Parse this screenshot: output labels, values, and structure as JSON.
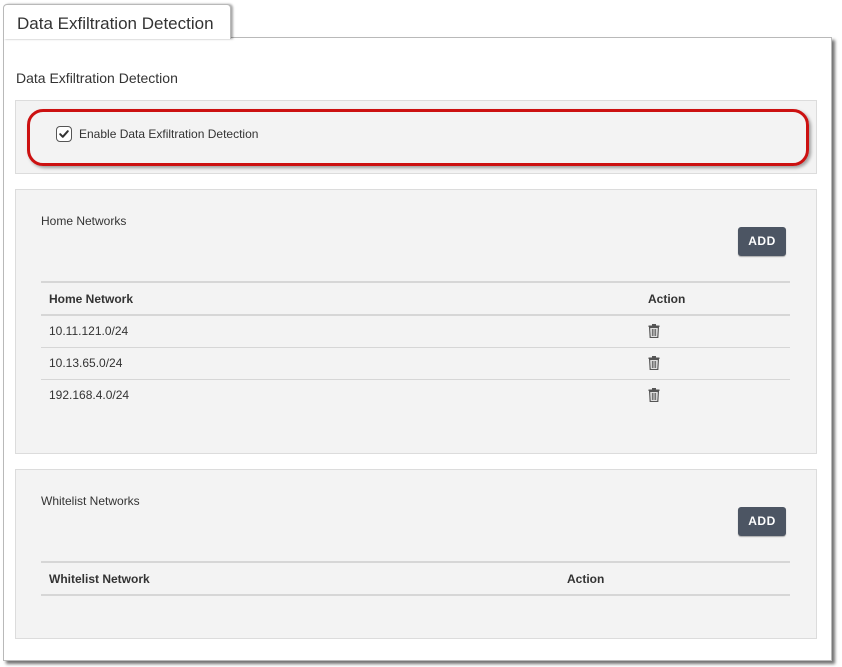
{
  "tab": {
    "label": "Data Exfiltration Detection"
  },
  "section_title": "Data Exfiltration Detection",
  "enable_option": {
    "label": "Enable Data Exfiltration Detection",
    "checked": true
  },
  "home_networks": {
    "title": "Home Networks",
    "add_label": "ADD",
    "columns": [
      "Home Network",
      "Action"
    ],
    "rows": [
      {
        "network": "10.11.121.0/24",
        "action_icon": "trash-icon"
      },
      {
        "network": "10.13.65.0/24",
        "action_icon": "trash-icon"
      },
      {
        "network": "192.168.4.0/24",
        "action_icon": "trash-icon"
      }
    ]
  },
  "whitelist_networks": {
    "title": "Whitelist Networks",
    "add_label": "ADD",
    "columns": [
      "Whitelist Network",
      "Action"
    ],
    "rows": []
  },
  "colors": {
    "highlight": "#cc1111",
    "button": "#4c5563",
    "box_bg": "#f3f3f3"
  }
}
